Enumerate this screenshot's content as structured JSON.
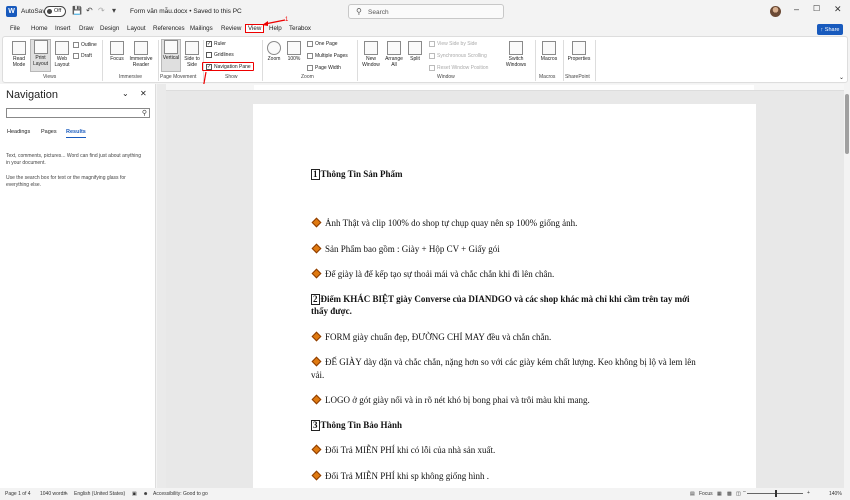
{
  "titlebar": {
    "autosave_label": "AutoSave",
    "autosave_state": "Off",
    "doc_title": "Form văn mẫu.docx • Saved to this PC",
    "search_placeholder": "Search"
  },
  "tabs": [
    "File",
    "Home",
    "Insert",
    "Draw",
    "Design",
    "Layout",
    "References",
    "Mailings",
    "Review",
    "View",
    "Help",
    "Terabox"
  ],
  "share_label": "Share",
  "ribbon": {
    "views": {
      "read_mode": "Read Mode",
      "print_layout": "Print Layout",
      "web_layout": "Web Layout",
      "outline": "Outline",
      "draft": "Draft",
      "label": "Views"
    },
    "immersive": {
      "focus": "Focus",
      "immersive_reader": "Immersive Reader",
      "label": "Immersive"
    },
    "page_movement": {
      "vertical": "Vertical",
      "side_to_side": "Side to Side",
      "label": "Page Movement"
    },
    "show": {
      "ruler": "Ruler",
      "gridlines": "Gridlines",
      "navigation_pane": "Navigation Pane",
      "label": "Show"
    },
    "zoom": {
      "zoom": "Zoom",
      "hundred": "100%",
      "one_page": "One Page",
      "multiple_pages": "Multiple Pages",
      "page_width": "Page Width",
      "label": "Zoom"
    },
    "window": {
      "new_window": "New Window",
      "arrange_all": "Arrange All",
      "split": "Split",
      "view_side_by_side": "View Side by Side",
      "sync_scrolling": "Synchronous Scrolling",
      "reset_window": "Reset Window Position",
      "switch_windows": "Switch Windows",
      "label": "Window"
    },
    "macros": {
      "macros": "Macros",
      "label": "Macros"
    },
    "sharepoint": {
      "properties": "Properties",
      "label": "SharePoint"
    }
  },
  "annotations": {
    "one": "1",
    "two": "2"
  },
  "navigation": {
    "title": "Navigation",
    "tabs": [
      "Headings",
      "Pages",
      "Results"
    ],
    "msg1": "Text, comments, pictures... Word can find just about anything in your document.",
    "msg2": "Use the search box for text or the magnifying glass for everything else."
  },
  "document": {
    "h1_num": "1",
    "h1": "Thông Tin Sản Phẩm",
    "b1": "Ảnh Thật và clip 100% do shop tự chụp quay nên sp 100% giống ảnh.",
    "b2": "Sản Phẩm bao gồm : Giày + Hộp CV + Giấy gói",
    "b3": "Để giày là để kếp tạo sự thoải mái và chắc chắn khi đi lên chân.",
    "h2_num": "2",
    "h2": "Điểm KHÁC BIỆT giày Converse của DIANDGO và các shop khác mà chỉ khi cầm trên tay mới thấy được.",
    "b4": "FORM giày chuẩn đẹp, ĐƯỜNG CHỈ MAY đều và chắn chắn.",
    "b5": "ĐẾ GIÀY dày dặn và chắc chắn, nặng hơn so với các giày kém chất lượng. Keo không bị lộ và lem lên vải.",
    "b6": "LOGO ở gót giày nổi và in rõ nét khó bị bong phai và trôi màu khi mang.",
    "h3_num": "3",
    "h3": "Thông Tin Bảo Hành",
    "b7": "Đổi Trả MIỄN PHÍ khi có lỗi của nhà sản xuất.",
    "b8": "Đổi Trả MIỄN PHÍ khi sp không giống hình ."
  },
  "status": {
    "page": "Page 1 of 4",
    "words": "1040 words",
    "language": "English (United States)",
    "accessibility": "Accessibility: Good to go",
    "focus": "Focus",
    "zoom": "140%"
  }
}
